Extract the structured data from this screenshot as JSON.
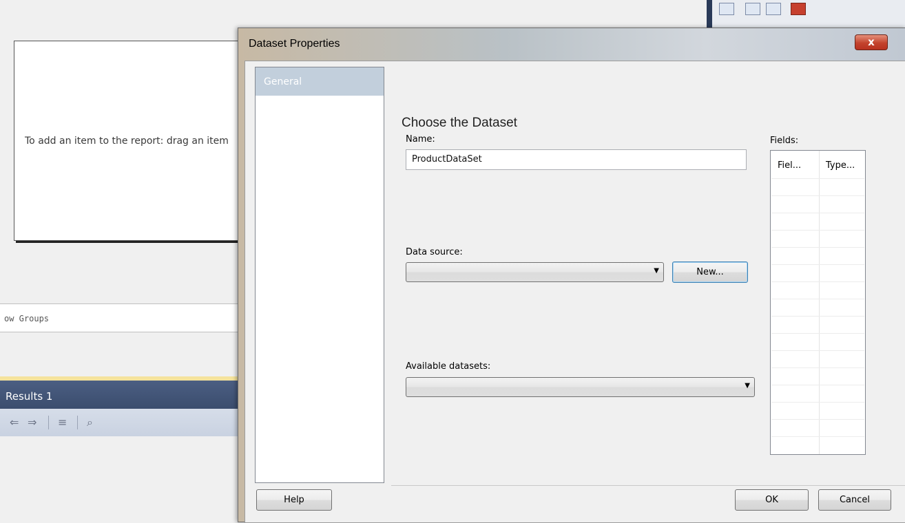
{
  "background": {
    "report_hint": "To add an item to the report: drag an item",
    "row_groups_label": "ow Groups",
    "results_tab_label": "Results 1"
  },
  "dialog": {
    "title": "Dataset Properties",
    "close_label": "x",
    "nav_items": [
      {
        "label": "General"
      }
    ],
    "section_title": "Choose the Dataset",
    "name_label": "Name:",
    "name_value": "ProductDataSet",
    "data_source_label": "Data source:",
    "data_source_value": "",
    "new_button_label": "New...",
    "available_datasets_label": "Available datasets:",
    "available_datasets_value": "",
    "fields_label": "Fields:",
    "fields_columns": [
      "Fiel...",
      "Type..."
    ],
    "help_button_label": "Help",
    "ok_button_label": "OK",
    "cancel_button_label": "Cancel"
  }
}
